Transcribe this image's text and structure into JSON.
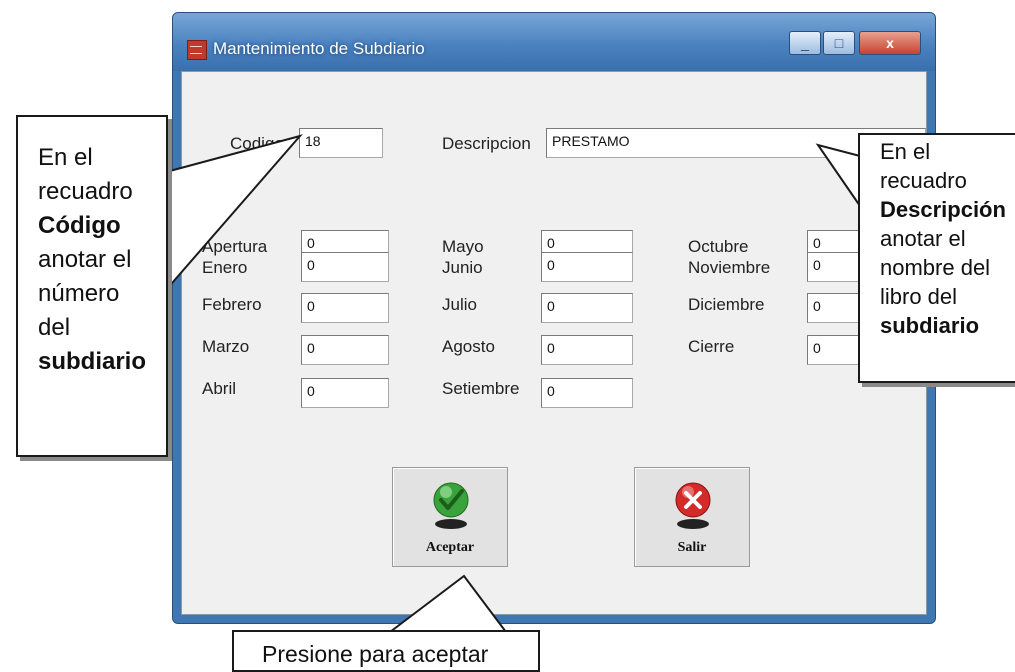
{
  "window": {
    "title": "Mantenimiento de Subdiario",
    "minimize": "_",
    "maximize": "□",
    "close": "x"
  },
  "form": {
    "codigo_label": "Codigo",
    "codigo_value": "18",
    "descripcion_label": "Descripcion",
    "descripcion_value": "PRESTAMO",
    "months": {
      "apertura": {
        "label": "Apertura",
        "value": "0"
      },
      "enero": {
        "label": "Enero",
        "value": "0"
      },
      "febrero": {
        "label": "Febrero",
        "value": "0"
      },
      "marzo": {
        "label": "Marzo",
        "value": "0"
      },
      "abril": {
        "label": "Abril",
        "value": "0"
      },
      "mayo": {
        "label": "Mayo",
        "value": "0"
      },
      "junio": {
        "label": "Junio",
        "value": "0"
      },
      "julio": {
        "label": "Julio",
        "value": "0"
      },
      "agosto": {
        "label": "Agosto",
        "value": "0"
      },
      "setiembre": {
        "label": "Setiembre",
        "value": "0"
      },
      "octubre": {
        "label": "Octubre",
        "value": "0"
      },
      "noviembre": {
        "label": "Noviembre",
        "value": "0"
      },
      "diciembre": {
        "label": "Diciembre",
        "value": "0"
      },
      "cierre": {
        "label": "Cierre",
        "value": "0"
      }
    }
  },
  "buttons": {
    "aceptar": {
      "label": "Aceptar",
      "icon": "green-check-icon",
      "color": "#3aa23a"
    },
    "salir": {
      "label": "Salir",
      "icon": "red-x-icon",
      "color": "#d42a2a"
    }
  },
  "callouts": {
    "left": {
      "t1": "En el",
      "t2": "recuadro",
      "t3": "Código",
      "t4": "anotar el",
      "t5": "número",
      "t6": "del",
      "t7": "subdiario"
    },
    "right": {
      "t1": "En el",
      "t2": "recuadro",
      "t3": "Descripción",
      "t4": "anotar el",
      "t5": "nombre del",
      "t6": "libro del",
      "t7": "subdiario"
    },
    "bottom": {
      "text": "Presione para aceptar"
    }
  }
}
